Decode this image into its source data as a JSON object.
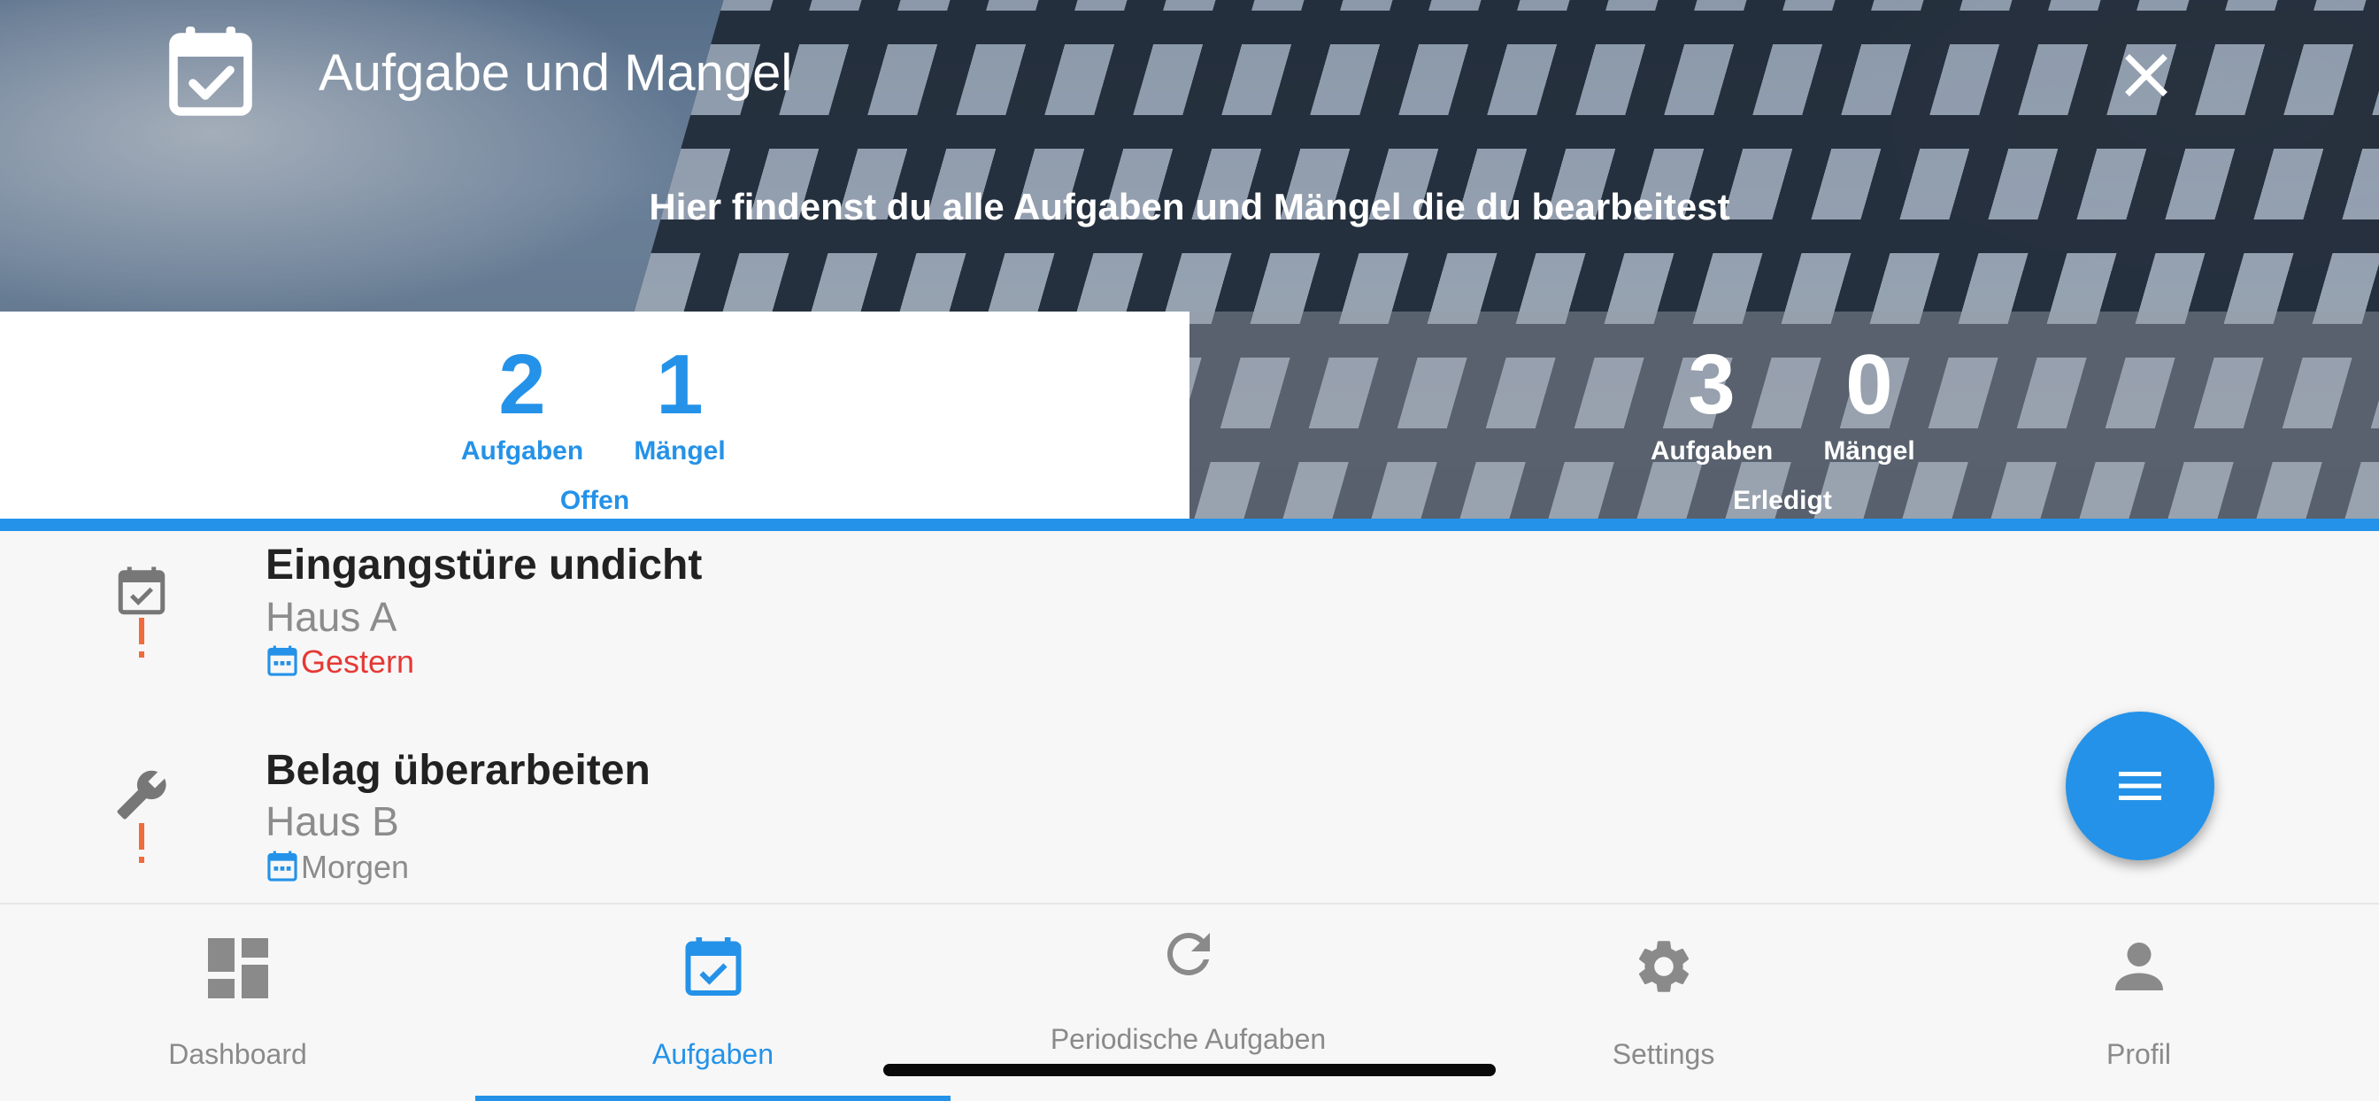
{
  "header": {
    "title": "Aufgabe und Mangel",
    "subtitle": "Hier findenst du alle Aufgaben und Mängel die du bearbeitest"
  },
  "tabs": {
    "open": {
      "label": "Offen",
      "tasks_count": "2",
      "tasks_label": "Aufgaben",
      "defects_count": "1",
      "defects_label": "Mängel",
      "active": true
    },
    "done": {
      "label": "Erledigt",
      "tasks_count": "3",
      "tasks_label": "Aufgaben",
      "defects_count": "0",
      "defects_label": "Mängel",
      "active": false
    }
  },
  "items": [
    {
      "type_icon": "calendar-check-icon",
      "priority_icon": "exclamation-icon",
      "title": "Eingangstüre undicht",
      "location": "Haus A",
      "date_icon": "calendar-icon",
      "due": "Gestern",
      "due_color": "#e53935"
    },
    {
      "type_icon": "wrench-icon",
      "priority_icon": "exclamation-icon",
      "title": "Belag überarbeiten",
      "location": "Haus B",
      "date_icon": "calendar-icon",
      "due": "Morgen",
      "due_color": "#8c8c8c"
    }
  ],
  "fab": {
    "icon": "menu-icon"
  },
  "bottom_nav": [
    {
      "label": "Dashboard",
      "icon": "dashboard-icon",
      "active": false
    },
    {
      "label": "Aufgaben",
      "icon": "calendar-check-icon",
      "active": true
    },
    {
      "label": "Periodische Aufgaben",
      "icon": "refresh-icon",
      "active": false
    },
    {
      "label": "Settings",
      "icon": "gear-icon",
      "active": false
    },
    {
      "label": "Profil",
      "icon": "person-icon",
      "active": false
    }
  ],
  "colors": {
    "accent": "#2492e8",
    "overdue": "#e53935",
    "priority": "#f06a3c",
    "icon_gray": "#8a8a8a"
  }
}
